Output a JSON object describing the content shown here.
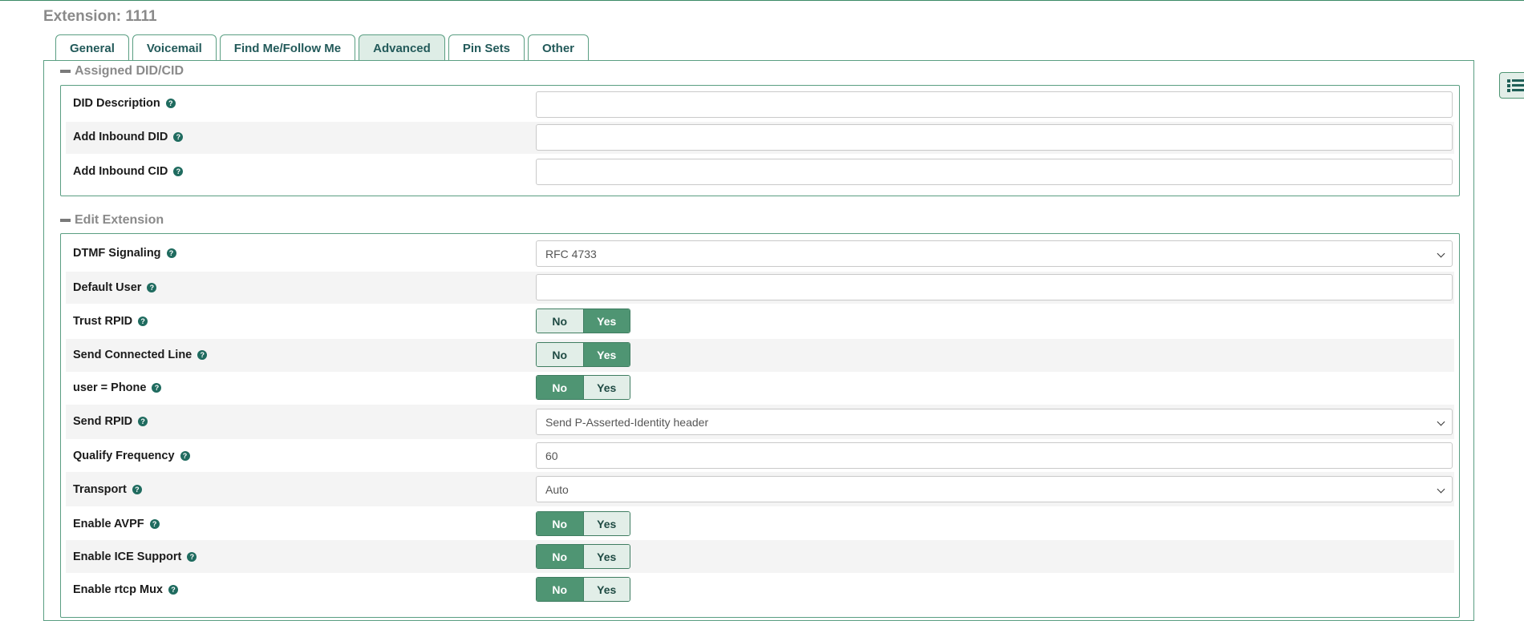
{
  "page": {
    "title": "Extension: 1111"
  },
  "tabs": [
    {
      "label": "General",
      "active": false
    },
    {
      "label": "Voicemail",
      "active": false
    },
    {
      "label": "Find Me/Follow Me",
      "active": false
    },
    {
      "label": "Advanced",
      "active": true
    },
    {
      "label": "Pin Sets",
      "active": false
    },
    {
      "label": "Other",
      "active": false
    }
  ],
  "sections": {
    "did": {
      "heading": "Assigned DID/CID",
      "fields": {
        "did_description": {
          "label": "DID Description",
          "value": ""
        },
        "add_inbound_did": {
          "label": "Add Inbound DID",
          "value": ""
        },
        "add_inbound_cid": {
          "label": "Add Inbound CID",
          "value": ""
        }
      }
    },
    "edit": {
      "heading": "Edit Extension",
      "fields": {
        "dtmf_signaling": {
          "label": "DTMF Signaling",
          "value": "RFC 4733"
        },
        "default_user": {
          "label": "Default User",
          "value": ""
        },
        "trust_rpid": {
          "label": "Trust RPID",
          "no": "No",
          "yes": "Yes",
          "selected": "Yes"
        },
        "send_connected_line": {
          "label": "Send Connected Line",
          "no": "No",
          "yes": "Yes",
          "selected": "Yes"
        },
        "user_phone": {
          "label": "user = Phone",
          "no": "No",
          "yes": "Yes",
          "selected": "No"
        },
        "send_rpid": {
          "label": "Send RPID",
          "value": "Send P-Asserted-Identity header"
        },
        "qualify_frequency": {
          "label": "Qualify Frequency",
          "value": "60"
        },
        "transport": {
          "label": "Transport",
          "value": "Auto"
        },
        "enable_avpf": {
          "label": "Enable AVPF",
          "no": "No",
          "yes": "Yes",
          "selected": "No"
        },
        "enable_ice": {
          "label": "Enable ICE Support",
          "no": "No",
          "yes": "Yes",
          "selected": "No"
        },
        "enable_rtcp_mux": {
          "label": "Enable rtcp Mux",
          "no": "No",
          "yes": "Yes",
          "selected": "No"
        }
      }
    }
  },
  "icons": {
    "help": "question-circle-icon",
    "side": "list-icon"
  },
  "colors": {
    "accent": "#4f9573",
    "border": "#5a9e82",
    "tab_text": "#235a5a"
  }
}
